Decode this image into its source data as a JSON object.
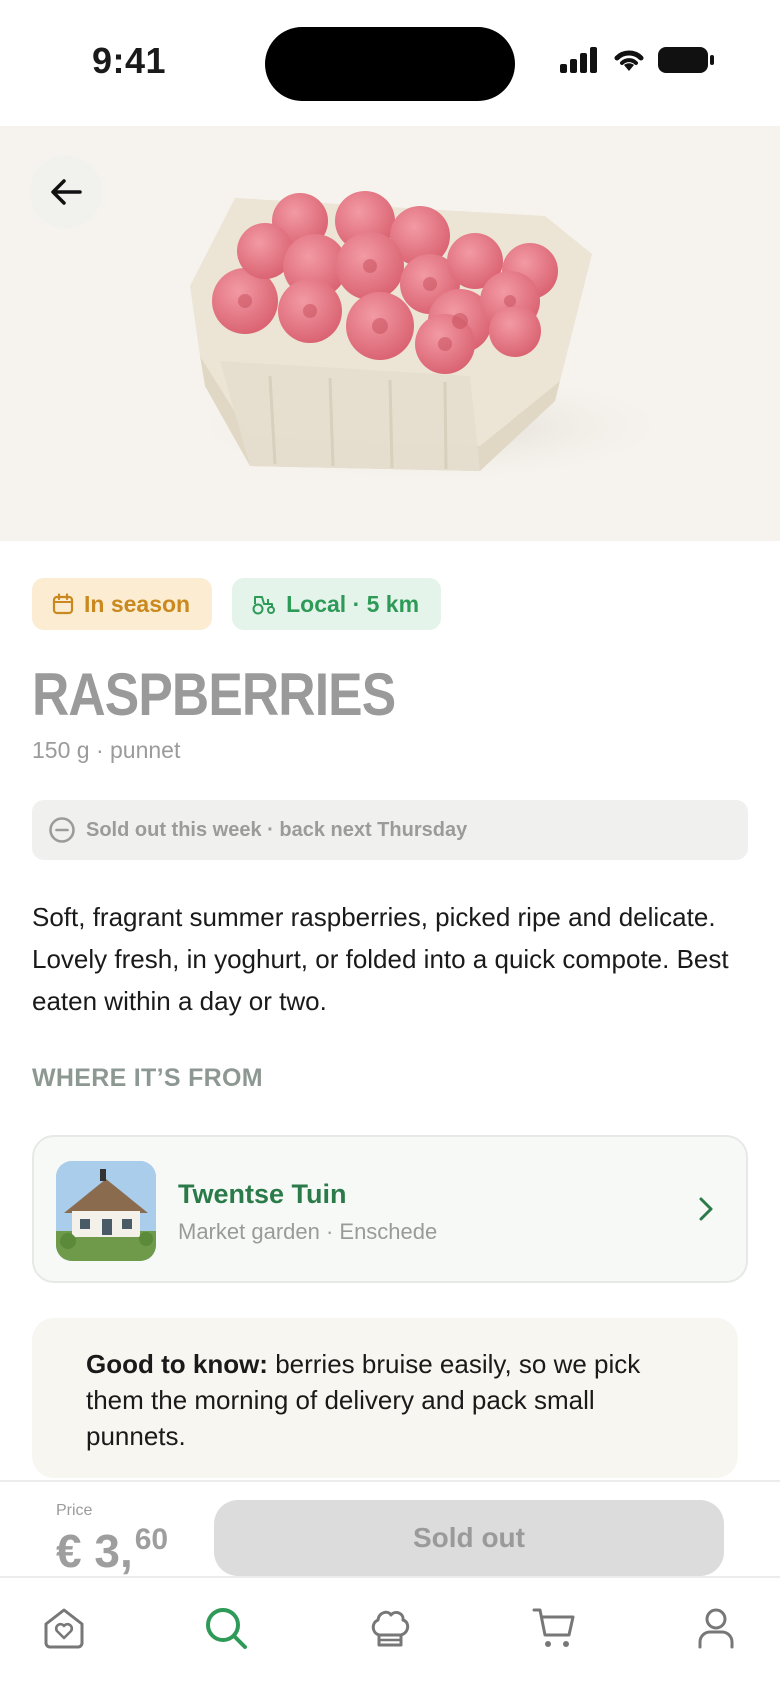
{
  "status_bar": {
    "time": "9:41"
  },
  "product": {
    "badges": [
      {
        "label": "In season",
        "icon": "calendar-icon",
        "color": "#c9891e"
      },
      {
        "label": "Local · 5 km",
        "icon": "tractor-icon",
        "color": "#2e9a58"
      }
    ],
    "title": "RASPBERRIES",
    "subtitle": "150 g · punnet",
    "availability": "Sold out this week · back next Thursday",
    "description": "Soft, fragrant summer raspberries, picked ripe and delicate. Lovely fresh, in yoghurt, or folded into a quick compote. Best eaten within a day or two."
  },
  "origin": {
    "section_label": "WHERE IT’S FROM",
    "farm_name": "Twentse Tuin",
    "farm_meta": "Market garden · Enschede"
  },
  "note": {
    "lead": "Good to know:",
    "text": " berries bruise easily, so we pick them the morning of delivery and pack small punnets."
  },
  "buy_bar": {
    "price_label": "Price",
    "price_main": "€ 3,",
    "price_cents": "60",
    "button_label": "Sold out"
  },
  "tabs": [
    {
      "icon": "home-heart-icon",
      "active": false
    },
    {
      "icon": "search-icon",
      "active": true
    },
    {
      "icon": "chef-hat-icon",
      "active": false
    },
    {
      "icon": "cart-icon",
      "active": false
    },
    {
      "icon": "profile-icon",
      "active": false
    }
  ],
  "colors": {
    "brand_green": "#2b7a49",
    "active_tab": "#2e9a58",
    "muted": "#9b9b9b"
  }
}
